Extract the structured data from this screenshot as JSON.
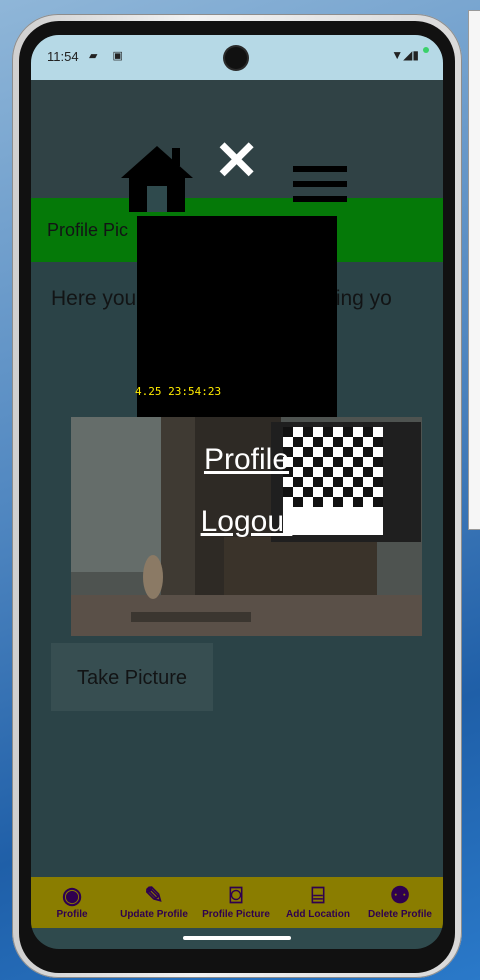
{
  "status_bar": {
    "time": "11:54",
    "left_icons": "▰ ▣",
    "right_icons": "▼◢▮"
  },
  "app": {
    "title": "Profile Pic",
    "instructions": "Here you can take a picture using yo",
    "take_picture_label": "Take Picture",
    "timestamp": "4.25 23:54:23"
  },
  "menu": {
    "profile_label": "Profile",
    "logout_label": "Logout"
  },
  "bottom_nav": {
    "items": [
      {
        "label": "Profile",
        "icon": "person-icon"
      },
      {
        "label": "Update Profile",
        "icon": "edit-person-icon"
      },
      {
        "label": "Profile Picture",
        "icon": "camera-icon"
      },
      {
        "label": "Add Location",
        "icon": "map-icon"
      },
      {
        "label": "Delete Profile",
        "icon": "remove-person-icon"
      }
    ]
  }
}
